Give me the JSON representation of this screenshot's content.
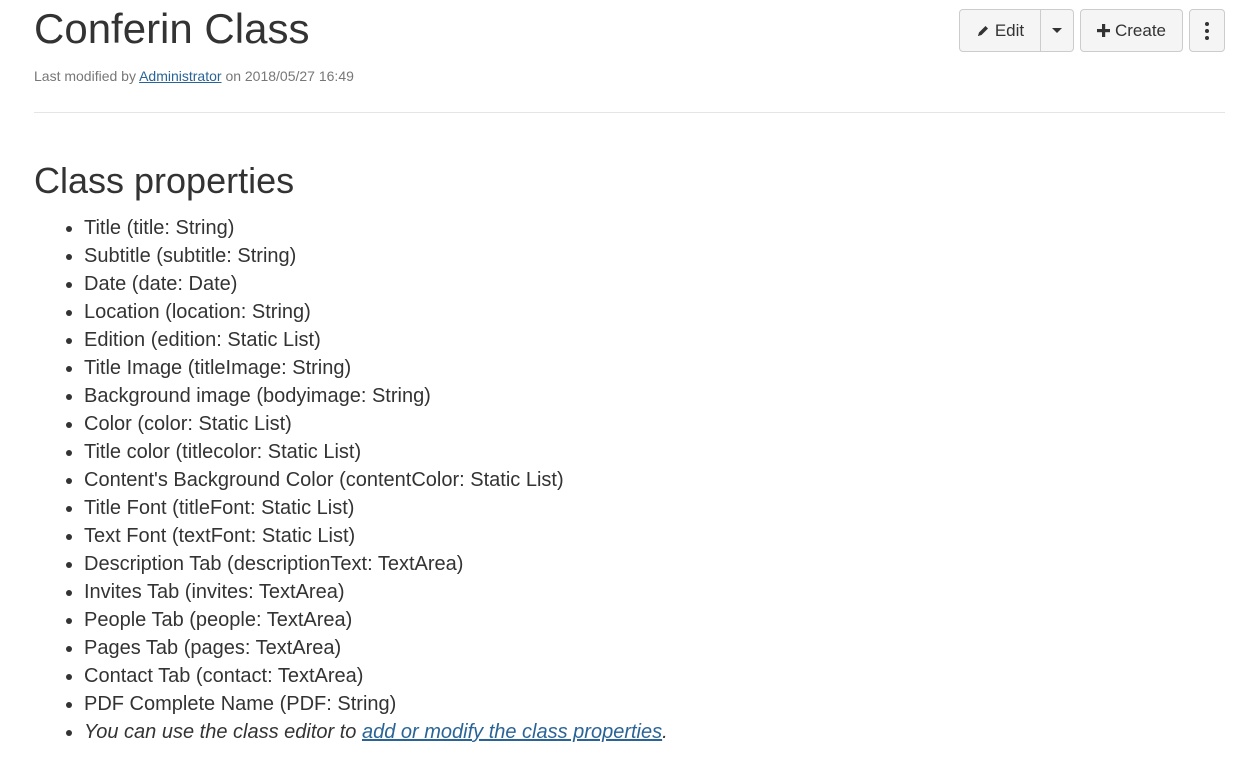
{
  "header": {
    "title": "Conferin Class",
    "meta_prefix": "Last modified by",
    "meta_author": "Administrator",
    "meta_suffix": "on 2018/05/27 16:49"
  },
  "toolbar": {
    "edit_label": "Edit",
    "create_label": "Create",
    "edit_icon": "pencil-icon",
    "create_icon": "plus-icon",
    "more_icon": "vertical-ellipsis-icon"
  },
  "section": {
    "title": "Class properties"
  },
  "properties": [
    "Title (title: String)",
    "Subtitle (subtitle: String)",
    "Date (date: Date)",
    "Location (location: String)",
    "Edition (edition: Static List)",
    "Title Image (titleImage: String)",
    "Background image (bodyimage: String)",
    "Color (color: Static List)",
    "Title color (titlecolor: Static List)",
    "Content's Background Color (contentColor: Static List)",
    "Title Font (titleFont: Static List)",
    "Text Font (textFont: Static List)",
    "Description Tab (descriptionText: TextArea)",
    "Invites Tab (invites: TextArea)",
    "People Tab (people: TextArea)",
    "Pages Tab (pages: TextArea)",
    "Contact Tab (contact: TextArea)",
    "PDF Complete Name (PDF: String)"
  ],
  "note": {
    "prefix": "You can use the class editor to",
    "link": "add or modify the class properties",
    "suffix": "."
  },
  "colors": {
    "link": "#2a6496",
    "text": "#333333",
    "meta": "#777777"
  }
}
